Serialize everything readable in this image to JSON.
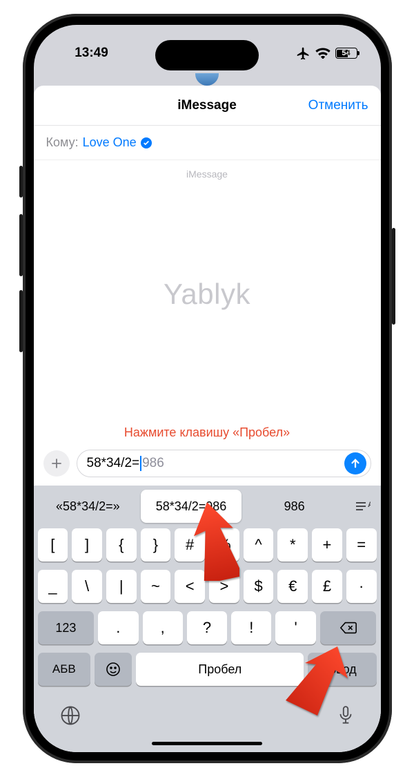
{
  "status": {
    "time": "13:49",
    "battery_pct": "54"
  },
  "nav": {
    "title": "iMessage",
    "cancel": "Отменить"
  },
  "recipient": {
    "label": "Кому:",
    "name": "Love One"
  },
  "thread_header": "iMessage",
  "watermark": "Yablyk",
  "instruction": "Нажмите клавишу «Пробел»",
  "compose": {
    "typed": "58*34/2=",
    "suggested_result": "986"
  },
  "suggestions": {
    "left": "«58*34/2=»",
    "center": "58*34/2=986",
    "right": "986"
  },
  "keyboard": {
    "row1": [
      "[",
      "]",
      "{",
      "}",
      "#",
      "%",
      "^",
      "*",
      "+",
      "="
    ],
    "row2": [
      "_",
      "\\",
      "|",
      "~",
      "<",
      ">",
      "$",
      "€",
      "£",
      "·"
    ],
    "row3": {
      "switch123": "123",
      "keys": [
        ".",
        ",",
        "?",
        "!",
        "'"
      ]
    },
    "row4": {
      "abv": "АБВ",
      "space": "Пробел",
      "enter": "Ввод"
    }
  }
}
